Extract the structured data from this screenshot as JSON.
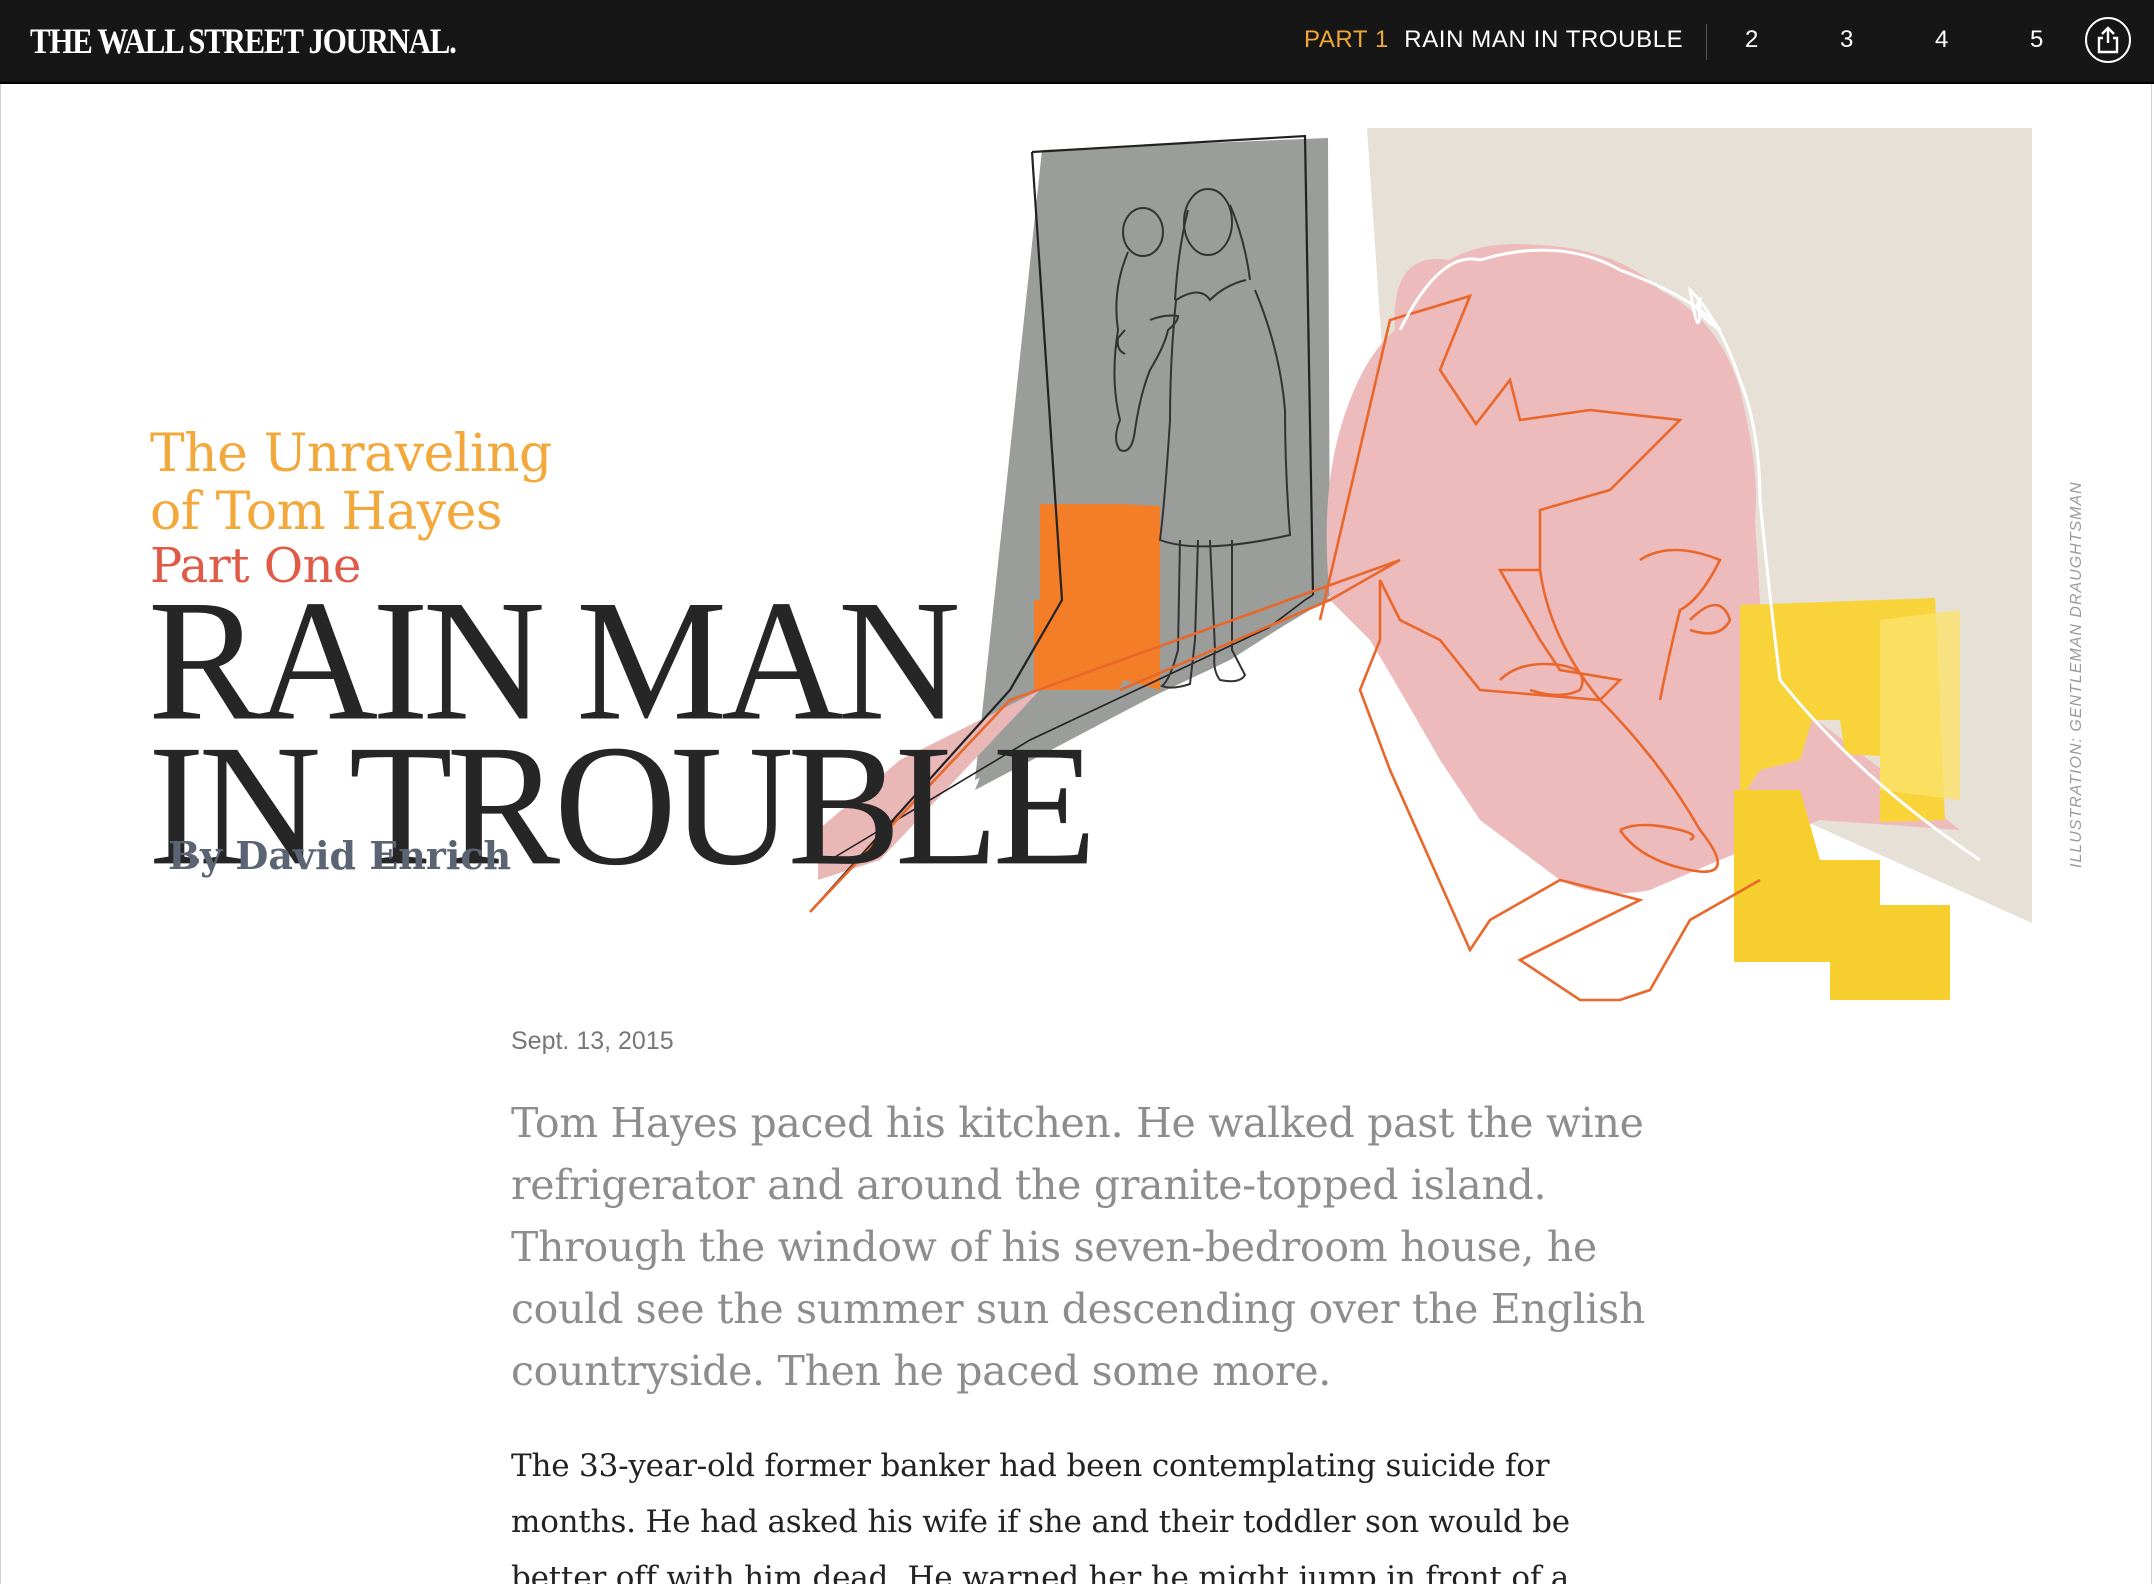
{
  "header": {
    "logo": "THE WALL STREET JOURNAL.",
    "current_part_label": "PART 1",
    "current_part_title": "RAIN MAN IN TROUBLE",
    "parts": [
      "2",
      "3",
      "4",
      "5"
    ],
    "share_icon": "share-icon"
  },
  "hero": {
    "series_title_lines": [
      "The Unraveling",
      "of Tom Hayes"
    ],
    "part": "Part One",
    "headline_lines": [
      "RAIN MAN",
      "IN TROUBLE"
    ],
    "byline": "By David Enrich",
    "illustration_credit": "ILLUSTRATION: GENTLEMAN DRAUGHTSMAN"
  },
  "article": {
    "date": "Sept. 13, 2015",
    "lede_lines": [
      "Tom Hayes paced his kitchen. He walked past the wine",
      "refrigerator and around the granite-topped island.",
      "Through the window of his seven-bedroom house, he",
      "could see the summer sun descending over the English",
      "countryside. Then he paced some more."
    ],
    "body_lines": [
      "The 33-year-old former banker had been contemplating suicide for",
      "months. He had asked his wife if she and their toddler son would be",
      "better off with him dead. He warned her he might jump in front of a"
    ]
  },
  "colors": {
    "topbar": "#161616",
    "part_accent": "#f0a734",
    "kicker": "#f3a83b",
    "part_one": "#e05a47",
    "headline": "#262626",
    "byline": "#5b6472"
  }
}
